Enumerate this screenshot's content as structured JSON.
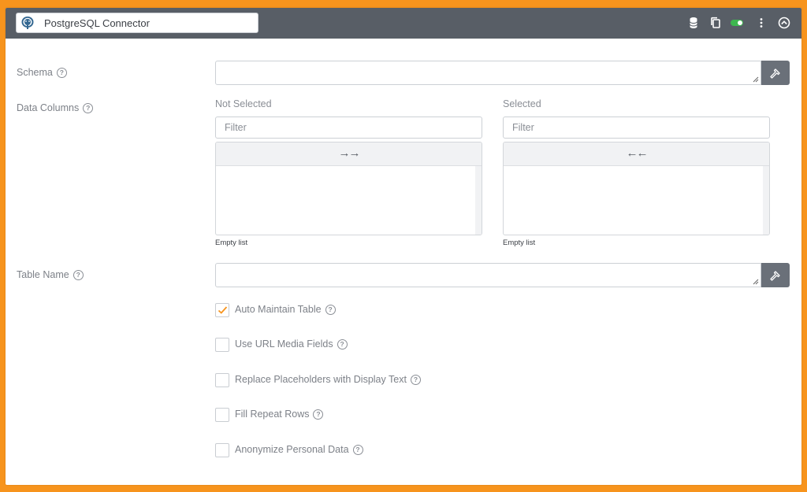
{
  "header": {
    "title": "PostgreSQL Connector",
    "icons": [
      "database-icon",
      "copy-icon",
      "toggle-switch",
      "more-vertical-icon",
      "collapse-up-icon"
    ],
    "toggle_color": "#3db74f"
  },
  "colors": {
    "accent": "#f7941d",
    "header_bg": "#585e66",
    "check": "#f7941d"
  },
  "form": {
    "schema": {
      "label": "Schema",
      "help": "?",
      "value": ""
    },
    "data_columns": {
      "label": "Data Columns",
      "help": "?",
      "not_selected": {
        "title": "Not Selected",
        "filter_placeholder": "Filter",
        "move_glyph": "→→",
        "items": [],
        "empty_text": "Empty list"
      },
      "selected": {
        "title": "Selected",
        "filter_placeholder": "Filter",
        "move_glyph": "←←",
        "items": [],
        "empty_text": "Empty list"
      }
    },
    "table_name": {
      "label": "Table Name",
      "help": "?",
      "value": ""
    },
    "options": [
      {
        "label": "Auto Maintain Table",
        "checked": true,
        "help": "?"
      },
      {
        "label": "Use URL Media Fields",
        "checked": false,
        "help": "?"
      },
      {
        "label": "Replace Placeholders with Display Text",
        "checked": false,
        "help": "?"
      },
      {
        "label": "Fill Repeat Rows",
        "checked": false,
        "help": "?"
      },
      {
        "label": "Anonymize Personal Data",
        "checked": false,
        "help": "?"
      }
    ]
  }
}
